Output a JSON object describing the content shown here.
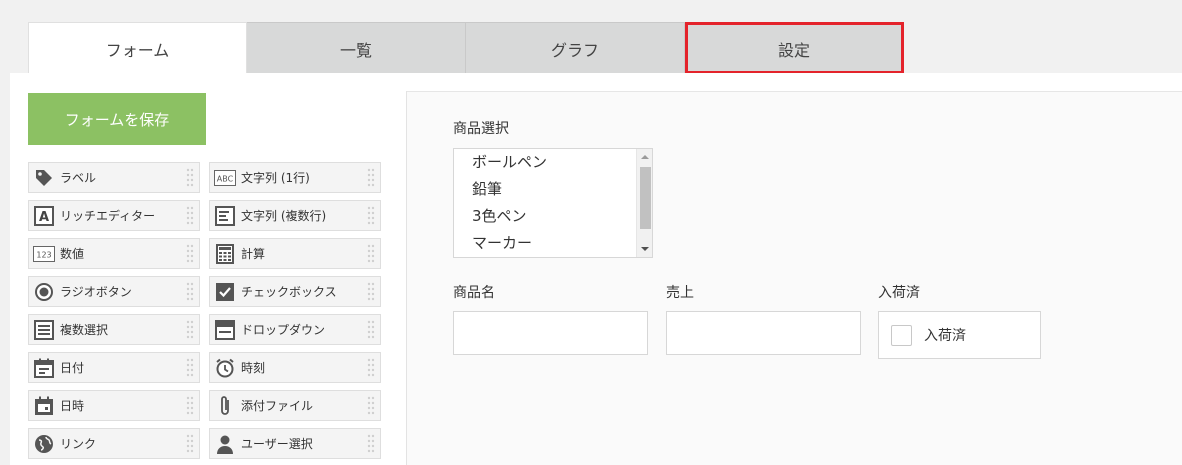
{
  "tabs": [
    {
      "label": "フォーム"
    },
    {
      "label": "一覧"
    },
    {
      "label": "グラフ"
    },
    {
      "label": "設定"
    }
  ],
  "save_button": {
    "label": "フォームを保存"
  },
  "palette": {
    "items": [
      {
        "label": "ラベル",
        "icon": "tag-icon"
      },
      {
        "label": "文字列 (1行)",
        "icon": "abc-text-icon"
      },
      {
        "label": "リッチエディター",
        "icon": "rich-editor-icon"
      },
      {
        "label": "文字列 (複数行)",
        "icon": "multiline-text-icon"
      },
      {
        "label": "数値",
        "icon": "number-icon"
      },
      {
        "label": "計算",
        "icon": "calculator-icon"
      },
      {
        "label": "ラジオボタン",
        "icon": "radio-icon"
      },
      {
        "label": "チェックボックス",
        "icon": "checkbox-icon"
      },
      {
        "label": "複数選択",
        "icon": "multi-select-icon"
      },
      {
        "label": "ドロップダウン",
        "icon": "dropdown-icon"
      },
      {
        "label": "日付",
        "icon": "calendar-icon"
      },
      {
        "label": "時刻",
        "icon": "alarm-clock-icon"
      },
      {
        "label": "日時",
        "icon": "datetime-icon"
      },
      {
        "label": "添付ファイル",
        "icon": "paperclip-icon"
      },
      {
        "label": "リンク",
        "icon": "globe-icon"
      },
      {
        "label": "ユーザー選択",
        "icon": "user-icon"
      }
    ]
  },
  "form": {
    "product_select": {
      "label": "商品選択",
      "options": [
        "ボールペン",
        "鉛筆",
        "3色ペン",
        "マーカー"
      ]
    },
    "product_name": {
      "label": "商品名",
      "value": ""
    },
    "sales": {
      "label": "売上",
      "value": ""
    },
    "received": {
      "label": "入荷済",
      "checkbox_label": "入荷済"
    }
  },
  "colors": {
    "save_button": "#8cc163",
    "highlight": "#e4232b"
  }
}
